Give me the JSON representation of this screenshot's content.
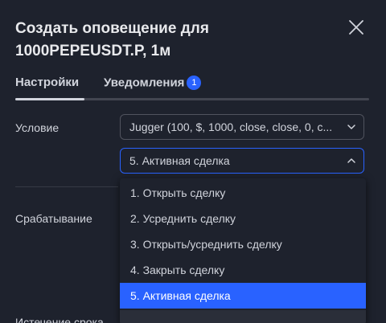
{
  "dialog": {
    "title_line1": "Создать оповещение для",
    "title_line2": "1000PEPEUSDT.P, 1м"
  },
  "tabs": [
    {
      "label": "Настройки",
      "active": true
    },
    {
      "label": "Уведомления",
      "badge": "1",
      "active": false
    }
  ],
  "fields": {
    "condition_label": "Условие",
    "trigger_label": "Срабатывание",
    "expiry_label": "Истечение срока"
  },
  "condition": {
    "indicator_value": "Jugger (100, $, 1000, close, close, 0, c...",
    "mode_value": "5. Активная сделка"
  },
  "menu": {
    "options": [
      "1. Открыть сделку",
      "2. Усреднить сделку",
      "3. Открыть/усреднить сделку",
      "4. Закрыть сделку",
      "5. Активная сделка"
    ],
    "selected_index": 4
  },
  "icons": {
    "close": "close-icon",
    "chevron_down": "chevron-down-icon",
    "chevron_up": "chevron-up-icon"
  },
  "colors": {
    "accent": "#2962ff",
    "background": "#1e222d",
    "text": "#d1d4dc"
  }
}
